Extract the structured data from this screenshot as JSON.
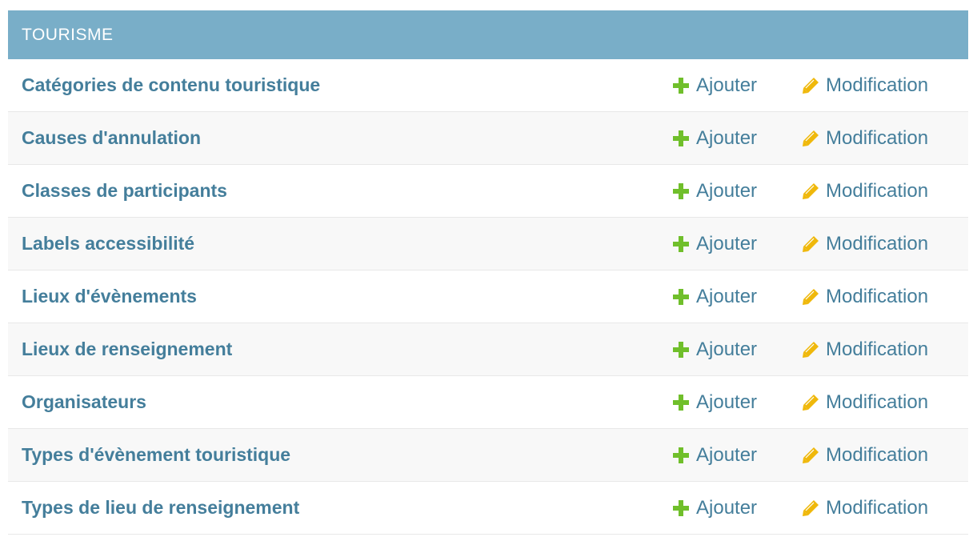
{
  "module": {
    "title": "TOURISME",
    "add_label": "Ajouter",
    "change_label": "Modification",
    "add_icon": "plus-icon",
    "change_icon": "pencil-icon",
    "colors": {
      "header_bg": "#79aec8",
      "link": "#447e9b",
      "add_icon": "#70bf2b",
      "change_icon": "#efb80b"
    },
    "rows": [
      {
        "name": "Catégories de contenu touristique"
      },
      {
        "name": "Causes d'annulation"
      },
      {
        "name": "Classes de participants"
      },
      {
        "name": "Labels accessibilité"
      },
      {
        "name": "Lieux d'évènements"
      },
      {
        "name": "Lieux de renseignement"
      },
      {
        "name": "Organisateurs"
      },
      {
        "name": "Types d'évènement touristique"
      },
      {
        "name": "Types de lieu de renseignement"
      }
    ]
  }
}
